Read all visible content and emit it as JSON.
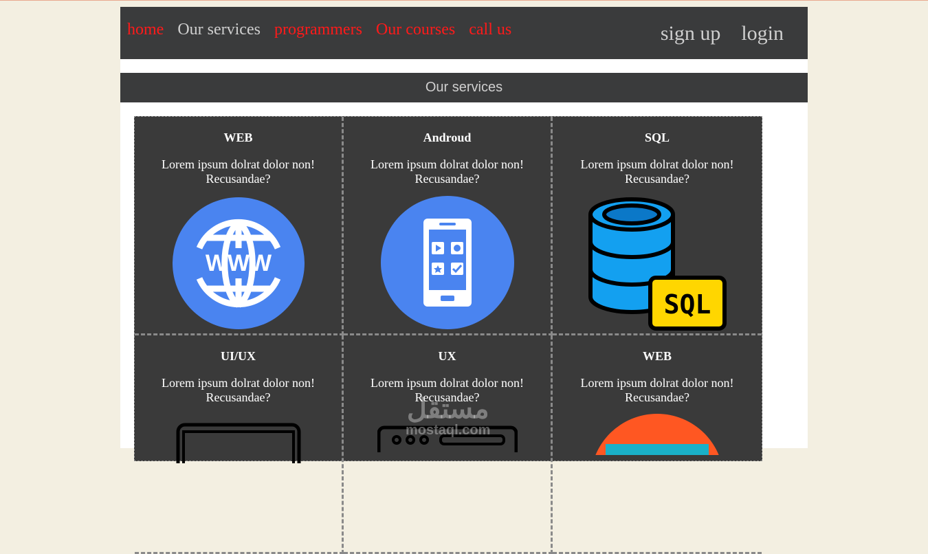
{
  "nav": {
    "left": [
      {
        "label": "home",
        "color": "#ff1a1a"
      },
      {
        "label": "Our services",
        "color": "#cfcfcf"
      },
      {
        "label": "programmers",
        "color": "#ff1a1a"
      },
      {
        "label": "Our courses",
        "color": "#ff1a1a"
      },
      {
        "label": "call us",
        "color": "#ff1a1a"
      }
    ],
    "right": [
      "sign up",
      "login"
    ]
  },
  "section_title": "Our services",
  "cards": [
    {
      "title": "WEB",
      "text": "Lorem ipsum dolrat dolor non! Recusandae?",
      "icon": "www-globe-icon"
    },
    {
      "title": "Androud",
      "text": "Lorem ipsum dolrat dolor non! Recusandae?",
      "icon": "smartphone-icon"
    },
    {
      "title": "SQL",
      "text": "Lorem ipsum dolrat dolor non! Recusandae?",
      "icon": "sql-database-icon"
    },
    {
      "title": "UI/UX",
      "text": "Lorem ipsum dolrat dolor non! Recusandae?",
      "icon": "monitor-icon"
    },
    {
      "title": "UX",
      "text": "Lorem ipsum dolrat dolor non! Recusandae?",
      "icon": "keyboard-icon"
    },
    {
      "title": "WEB",
      "text": "Lorem ipsum dolrat dolor non! Recusandae?",
      "icon": "web-browser-icon"
    }
  ],
  "watermark": {
    "arabic": "مستقل",
    "latin": "mostaql.com"
  }
}
